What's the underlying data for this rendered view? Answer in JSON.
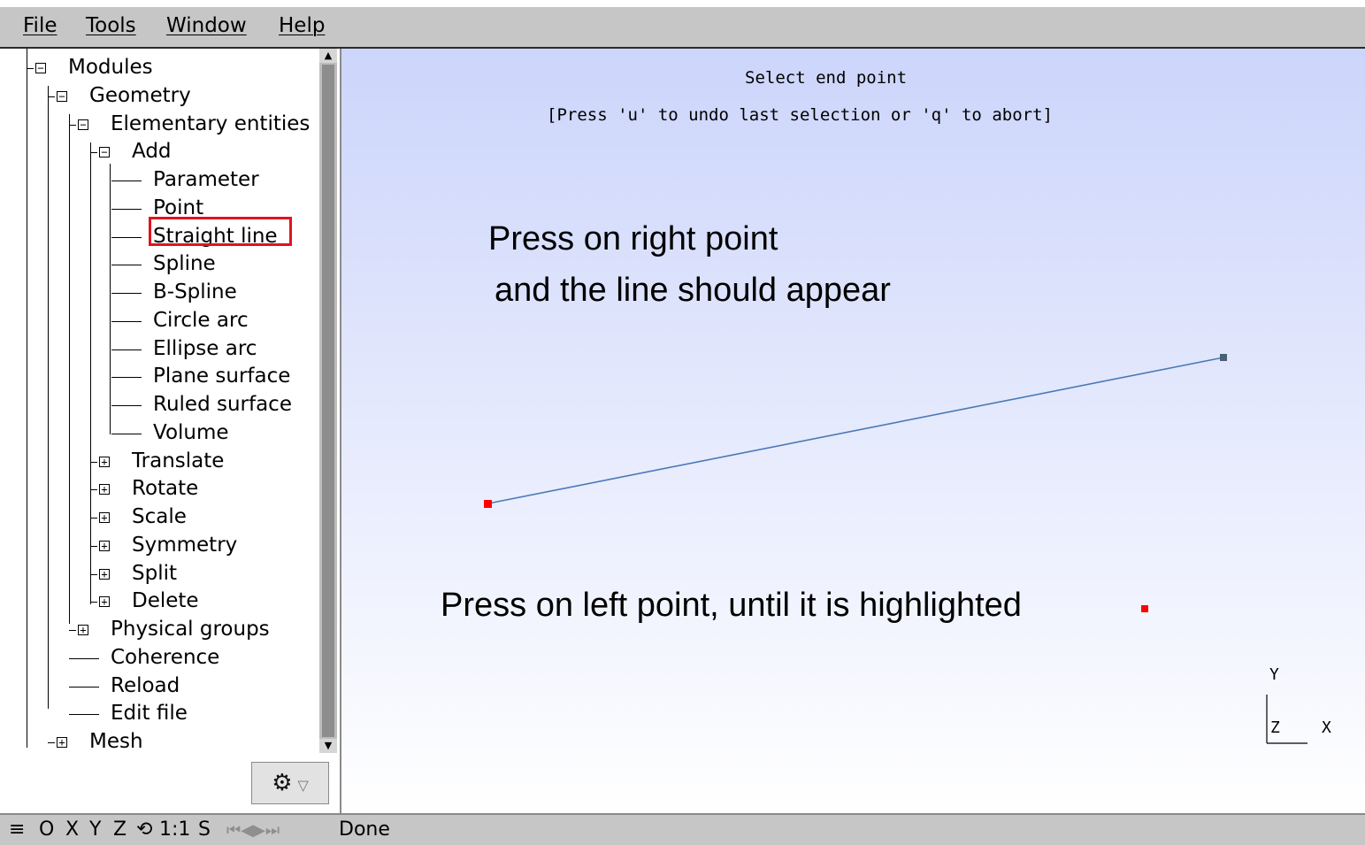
{
  "menubar": {
    "file": "File",
    "tools": "Tools",
    "window": "Window",
    "help": "Help"
  },
  "tree": {
    "modules": "Modules",
    "geometry": "Geometry",
    "elementary": "Elementary entities",
    "add": "Add",
    "add_items": [
      "Parameter",
      "Point",
      "Straight line",
      "Spline",
      "B-Spline",
      "Circle arc",
      "Ellipse arc",
      "Plane surface",
      "Ruled surface",
      "Volume"
    ],
    "ops": [
      "Translate",
      "Rotate",
      "Scale",
      "Symmetry",
      "Split",
      "Delete"
    ],
    "physical_groups": "Physical groups",
    "coherence": "Coherence",
    "reload": "Reload",
    "edit_file": "Edit file",
    "mesh": "Mesh",
    "selected_item": "Straight line"
  },
  "viewport": {
    "prompt": "Select end point",
    "hint": "[Press 'u' to undo last selection or 'q' to abort]",
    "annotation_right_1": "Press on right point",
    "annotation_right_2": "and the line should appear",
    "annotation_left": "Press on left point, until it is highlighted",
    "axis_y": "Y",
    "axis_z": "Z",
    "axis_x": "X",
    "line_color": "#4a79b5",
    "highlight_color": "#ff0000"
  },
  "statusbar": {
    "menu_icon": "≡",
    "o": "O",
    "x": "X",
    "y": "Y",
    "z": "Z",
    "rotate_icon": "⟲",
    "scale": "1:1",
    "s": "S",
    "nav_icons": "⏮◀▶⏭",
    "status": "Done"
  }
}
